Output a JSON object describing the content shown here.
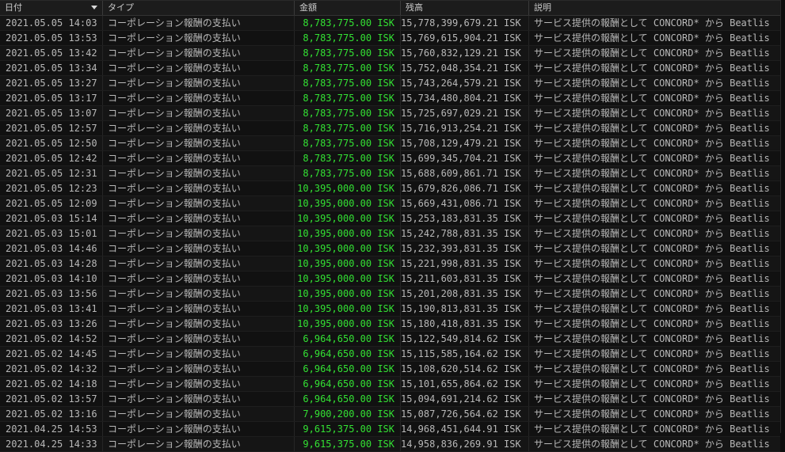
{
  "columns": {
    "date": "日付",
    "type": "タイプ",
    "amount": "金額",
    "balance": "残高",
    "description": "説明"
  },
  "rows": [
    {
      "date": "2021.05.05 14:03",
      "type": "コーポレーション報酬の支払い",
      "amount": "8,783,775.00 ISK",
      "balance": "15,778,399,679.21 ISK",
      "description": "サービス提供の報酬として CONCORD* から Beatlis"
    },
    {
      "date": "2021.05.05 13:53",
      "type": "コーポレーション報酬の支払い",
      "amount": "8,783,775.00 ISK",
      "balance": "15,769,615,904.21 ISK",
      "description": "サービス提供の報酬として CONCORD* から Beatlis"
    },
    {
      "date": "2021.05.05 13:42",
      "type": "コーポレーション報酬の支払い",
      "amount": "8,783,775.00 ISK",
      "balance": "15,760,832,129.21 ISK",
      "description": "サービス提供の報酬として CONCORD* から Beatlis"
    },
    {
      "date": "2021.05.05 13:34",
      "type": "コーポレーション報酬の支払い",
      "amount": "8,783,775.00 ISK",
      "balance": "15,752,048,354.21 ISK",
      "description": "サービス提供の報酬として CONCORD* から Beatlis"
    },
    {
      "date": "2021.05.05 13:27",
      "type": "コーポレーション報酬の支払い",
      "amount": "8,783,775.00 ISK",
      "balance": "15,743,264,579.21 ISK",
      "description": "サービス提供の報酬として CONCORD* から Beatlis"
    },
    {
      "date": "2021.05.05 13:17",
      "type": "コーポレーション報酬の支払い",
      "amount": "8,783,775.00 ISK",
      "balance": "15,734,480,804.21 ISK",
      "description": "サービス提供の報酬として CONCORD* から Beatlis"
    },
    {
      "date": "2021.05.05 13:07",
      "type": "コーポレーション報酬の支払い",
      "amount": "8,783,775.00 ISK",
      "balance": "15,725,697,029.21 ISK",
      "description": "サービス提供の報酬として CONCORD* から Beatlis"
    },
    {
      "date": "2021.05.05 12:57",
      "type": "コーポレーション報酬の支払い",
      "amount": "8,783,775.00 ISK",
      "balance": "15,716,913,254.21 ISK",
      "description": "サービス提供の報酬として CONCORD* から Beatlis"
    },
    {
      "date": "2021.05.05 12:50",
      "type": "コーポレーション報酬の支払い",
      "amount": "8,783,775.00 ISK",
      "balance": "15,708,129,479.21 ISK",
      "description": "サービス提供の報酬として CONCORD* から Beatlis"
    },
    {
      "date": "2021.05.05 12:42",
      "type": "コーポレーション報酬の支払い",
      "amount": "8,783,775.00 ISK",
      "balance": "15,699,345,704.21 ISK",
      "description": "サービス提供の報酬として CONCORD* から Beatlis"
    },
    {
      "date": "2021.05.05 12:31",
      "type": "コーポレーション報酬の支払い",
      "amount": "8,783,775.00 ISK",
      "balance": "15,688,609,861.71 ISK",
      "description": "サービス提供の報酬として CONCORD* から Beatlis"
    },
    {
      "date": "2021.05.05 12:23",
      "type": "コーポレーション報酬の支払い",
      "amount": "10,395,000.00 ISK",
      "balance": "15,679,826,086.71 ISK",
      "description": "サービス提供の報酬として CONCORD* から Beatlis"
    },
    {
      "date": "2021.05.05 12:09",
      "type": "コーポレーション報酬の支払い",
      "amount": "10,395,000.00 ISK",
      "balance": "15,669,431,086.71 ISK",
      "description": "サービス提供の報酬として CONCORD* から Beatlis"
    },
    {
      "date": "2021.05.03 15:14",
      "type": "コーポレーション報酬の支払い",
      "amount": "10,395,000.00 ISK",
      "balance": "15,253,183,831.35 ISK",
      "description": "サービス提供の報酬として CONCORD* から Beatlis"
    },
    {
      "date": "2021.05.03 15:01",
      "type": "コーポレーション報酬の支払い",
      "amount": "10,395,000.00 ISK",
      "balance": "15,242,788,831.35 ISK",
      "description": "サービス提供の報酬として CONCORD* から Beatlis"
    },
    {
      "date": "2021.05.03 14:46",
      "type": "コーポレーション報酬の支払い",
      "amount": "10,395,000.00 ISK",
      "balance": "15,232,393,831.35 ISK",
      "description": "サービス提供の報酬として CONCORD* から Beatlis"
    },
    {
      "date": "2021.05.03 14:28",
      "type": "コーポレーション報酬の支払い",
      "amount": "10,395,000.00 ISK",
      "balance": "15,221,998,831.35 ISK",
      "description": "サービス提供の報酬として CONCORD* から Beatlis"
    },
    {
      "date": "2021.05.03 14:10",
      "type": "コーポレーション報酬の支払い",
      "amount": "10,395,000.00 ISK",
      "balance": "15,211,603,831.35 ISK",
      "description": "サービス提供の報酬として CONCORD* から Beatlis"
    },
    {
      "date": "2021.05.03 13:56",
      "type": "コーポレーション報酬の支払い",
      "amount": "10,395,000.00 ISK",
      "balance": "15,201,208,831.35 ISK",
      "description": "サービス提供の報酬として CONCORD* から Beatlis"
    },
    {
      "date": "2021.05.03 13:41",
      "type": "コーポレーション報酬の支払い",
      "amount": "10,395,000.00 ISK",
      "balance": "15,190,813,831.35 ISK",
      "description": "サービス提供の報酬として CONCORD* から Beatlis"
    },
    {
      "date": "2021.05.03 13:26",
      "type": "コーポレーション報酬の支払い",
      "amount": "10,395,000.00 ISK",
      "balance": "15,180,418,831.35 ISK",
      "description": "サービス提供の報酬として CONCORD* から Beatlis"
    },
    {
      "date": "2021.05.02 14:52",
      "type": "コーポレーション報酬の支払い",
      "amount": "6,964,650.00 ISK",
      "balance": "15,122,549,814.62 ISK",
      "description": "サービス提供の報酬として CONCORD* から Beatlis"
    },
    {
      "date": "2021.05.02 14:45",
      "type": "コーポレーション報酬の支払い",
      "amount": "6,964,650.00 ISK",
      "balance": "15,115,585,164.62 ISK",
      "description": "サービス提供の報酬として CONCORD* から Beatlis"
    },
    {
      "date": "2021.05.02 14:32",
      "type": "コーポレーション報酬の支払い",
      "amount": "6,964,650.00 ISK",
      "balance": "15,108,620,514.62 ISK",
      "description": "サービス提供の報酬として CONCORD* から Beatlis"
    },
    {
      "date": "2021.05.02 14:18",
      "type": "コーポレーション報酬の支払い",
      "amount": "6,964,650.00 ISK",
      "balance": "15,101,655,864.62 ISK",
      "description": "サービス提供の報酬として CONCORD* から Beatlis"
    },
    {
      "date": "2021.05.02 13:57",
      "type": "コーポレーション報酬の支払い",
      "amount": "6,964,650.00 ISK",
      "balance": "15,094,691,214.62 ISK",
      "description": "サービス提供の報酬として CONCORD* から Beatlis"
    },
    {
      "date": "2021.05.02 13:16",
      "type": "コーポレーション報酬の支払い",
      "amount": "7,900,200.00 ISK",
      "balance": "15,087,726,564.62 ISK",
      "description": "サービス提供の報酬として CONCORD* から Beatlis"
    },
    {
      "date": "2021.04.25 14:53",
      "type": "コーポレーション報酬の支払い",
      "amount": "9,615,375.00 ISK",
      "balance": "14,968,451,644.91 ISK",
      "description": "サービス提供の報酬として CONCORD* から Beatlis"
    },
    {
      "date": "2021.04.25 14:33",
      "type": "コーポレーション報酬の支払い",
      "amount": "9,615,375.00 ISK",
      "balance": "14,958,836,269.91 ISK",
      "description": "サービス提供の報酬として CONCORD* から Beatlis"
    }
  ],
  "colors": {
    "amount_positive": "#33e133",
    "text": "#b8b8b8",
    "background": "#101010"
  },
  "sort": {
    "column": "date",
    "direction": "descending",
    "icon": "sort-descending-arrow-icon"
  }
}
